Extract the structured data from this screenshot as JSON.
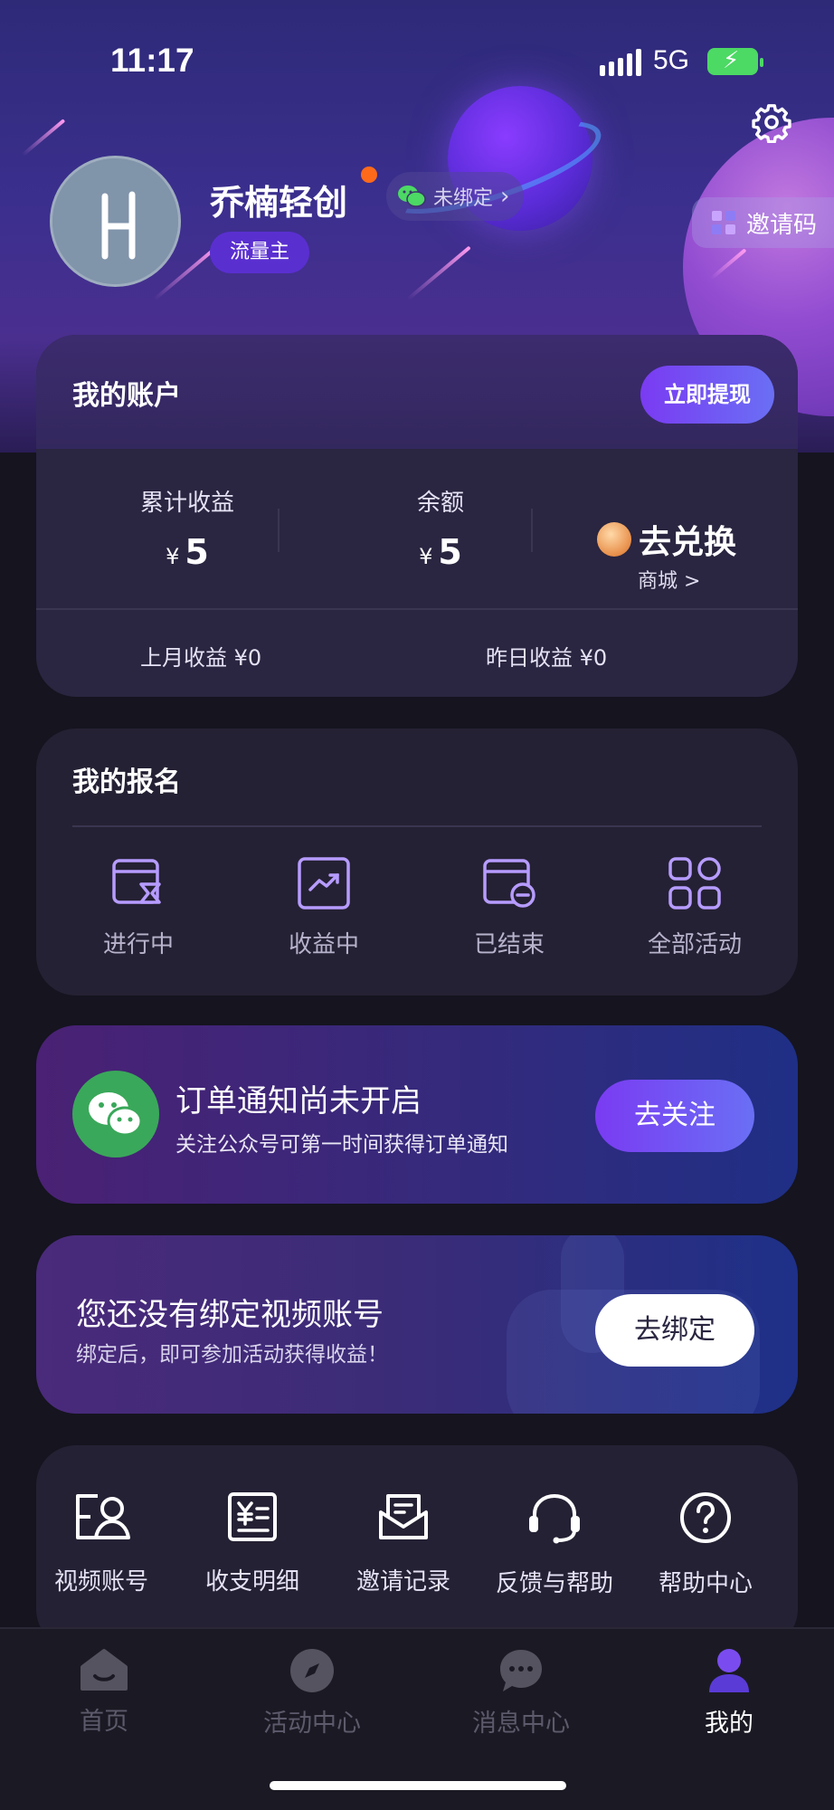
{
  "status_bar": {
    "time": "11:17",
    "network": "5G"
  },
  "profile": {
    "nickname": "乔楠轻创",
    "wechat_bind_status": "未绑定",
    "role_badge": "流量主",
    "invite_code_label": "邀请码"
  },
  "account": {
    "title": "我的账户",
    "withdraw_label": "立即提现",
    "currency_symbol": "¥",
    "total_income_label": "累计收益",
    "total_income_value": "5",
    "balance_label": "余额",
    "balance_value": "5",
    "exchange_label": "去兑换",
    "shop_label": "商城 >",
    "last_month_income": "上月收益 ¥0",
    "yesterday_income": "昨日收益 ¥0"
  },
  "enrollment": {
    "title": "我的报名",
    "items": [
      {
        "label": "进行中",
        "icon": "hourglass-card-icon"
      },
      {
        "label": "收益中",
        "icon": "trend-chart-icon"
      },
      {
        "label": "已结束",
        "icon": "card-minus-icon"
      },
      {
        "label": "全部活动",
        "icon": "grid-icon"
      }
    ]
  },
  "order_notice": {
    "title": "订单通知尚未开启",
    "subtitle": "关注公众号可第一时间获得订单通知",
    "button_label": "去关注"
  },
  "video_bind_notice": {
    "title": "您还没有绑定视频账号",
    "subtitle": "绑定后，即可参加活动获得收益！",
    "button_label": "去绑定"
  },
  "tools": [
    {
      "label": "视频账号",
      "icon": "user-card-icon"
    },
    {
      "label": "收支明细",
      "icon": "yuan-ledger-icon"
    },
    {
      "label": "邀请记录",
      "icon": "envelope-icon"
    },
    {
      "label": "反馈与帮助",
      "icon": "headset-icon"
    },
    {
      "label": "帮助中心",
      "icon": "question-circle-icon"
    }
  ],
  "tabbar": [
    {
      "label": "首页",
      "icon": "home-icon",
      "active": false
    },
    {
      "label": "活动中心",
      "icon": "compass-icon",
      "active": false
    },
    {
      "label": "消息中心",
      "icon": "chat-bubble-icon",
      "active": false
    },
    {
      "label": "我的",
      "icon": "person-icon",
      "active": true
    }
  ],
  "colors": {
    "accent_gradient_start": "#7a3bf2",
    "accent_gradient_end": "#6a6ff5",
    "wechat_green": "#3aa85a",
    "notification_dot": "#ff6a1a",
    "page_background": "#15141f",
    "card_background": "#252134"
  }
}
